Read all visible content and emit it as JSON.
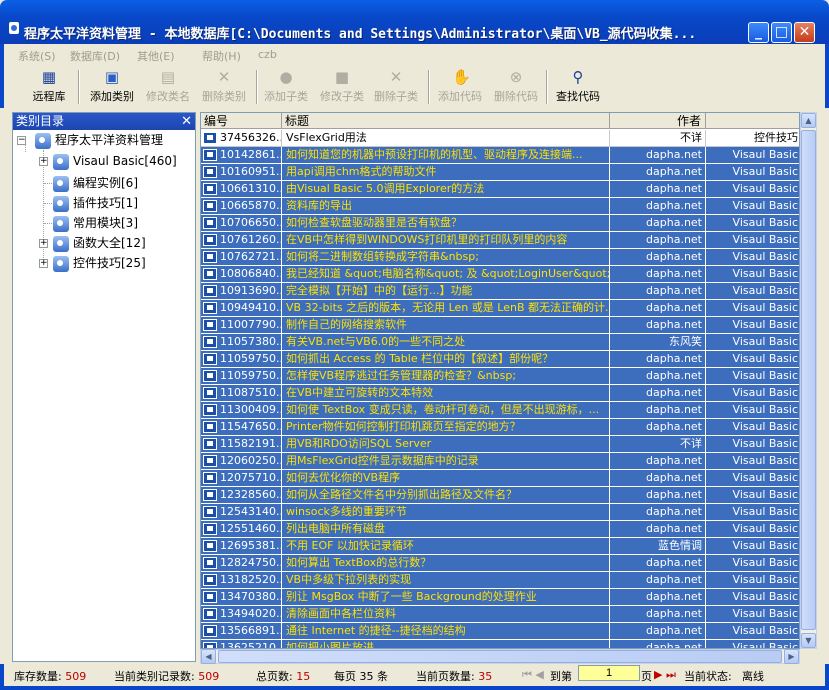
{
  "window": {
    "title": "程序太平洋资料管理 - 本地数据库[C:\\Documents and Settings\\Administrator\\桌面\\VB_源代码收集..."
  },
  "menu": [
    "系统(S)",
    "数据库(D)",
    "其他(E)",
    "帮助(H)",
    "czb"
  ],
  "toolbar": {
    "remote": "远程库",
    "add_category": "添加类别",
    "rename_category": "修改类名",
    "delete_category": "删除类别",
    "add_subcategory": "添加子类",
    "edit_subcategory": "修改子类",
    "delete_subcategory": "删除子类",
    "add_code": "添加代码",
    "delete_code": "删除代码",
    "find_code": "查找代码"
  },
  "catalog": {
    "header": "类别目录",
    "root": "程序太平洋资料管理",
    "items": [
      "Visaul Basic[460]",
      "编程实例[6]",
      "插件技巧[1]",
      "常用模块[3]",
      "函数大全[12]",
      "控件技巧[25]"
    ]
  },
  "grid": {
    "columns": [
      "编号",
      "标题",
      "作者",
      ""
    ],
    "rows": [
      {
        "id": "37456326...",
        "title": "VsFlexGrid用法",
        "author": "不详",
        "cat": "控件技巧"
      },
      {
        "id": "10142861...",
        "title": "如何知道您的机器中预设打印机的机型、驱动程序及连接端...",
        "author": "dapha.net",
        "cat": "Visaul Basic"
      },
      {
        "id": "10160951...",
        "title": "用api调用chm格式的帮助文件",
        "author": "dapha.net",
        "cat": "Visaul Basic"
      },
      {
        "id": "10661310...",
        "title": "由Visual Basic 5.0调用Explorer的方法",
        "author": "dapha.net",
        "cat": "Visaul Basic"
      },
      {
        "id": "10665870...",
        "title": "资料库的导出",
        "author": "dapha.net",
        "cat": "Visaul Basic"
      },
      {
        "id": "10706650...",
        "title": "如何检查软盘驱动器里是否有软盘？",
        "author": "dapha.net",
        "cat": "Visaul Basic"
      },
      {
        "id": "10761260...",
        "title": "在VB中怎样得到WINDOWS打印机里的打印队列里的内容",
        "author": "dapha.net",
        "cat": "Visaul Basic"
      },
      {
        "id": "10762721...",
        "title": "如何将二进制数组转换成字符串&nbsp;",
        "author": "dapha.net",
        "cat": "Visaul Basic"
      },
      {
        "id": "10806840...",
        "title": "我已经知道 &quot;电脑名称&quot; 及 &quot;LoginUser&quot; 的...",
        "author": "dapha.net",
        "cat": "Visaul Basic"
      },
      {
        "id": "10913690...",
        "title": "完全模拟【开始】中的【运行...】功能",
        "author": "dapha.net",
        "cat": "Visaul Basic"
      },
      {
        "id": "10949410...",
        "title": "VB 32-bits 之后的版本，无论用 Len 或是 LenB 都无法正确的计...",
        "author": "dapha.net",
        "cat": "Visaul Basic"
      },
      {
        "id": "11007790...",
        "title": "制作自己的网络搜索软件",
        "author": "dapha.net",
        "cat": "Visaul Basic"
      },
      {
        "id": "11057380...",
        "title": "有关VB.net与VB6.0的一些不同之处",
        "author": "东风笑",
        "cat": "Visaul Basic"
      },
      {
        "id": "11059750...",
        "title": "如何抓出 Access 的 Table 栏位中的【叙述】部份呢？",
        "author": "dapha.net",
        "cat": "Visaul Basic"
      },
      {
        "id": "11059750...",
        "title": "怎样使VB程序逃过任务管理器的检查？&nbsp;",
        "author": "dapha.net",
        "cat": "Visaul Basic"
      },
      {
        "id": "11087510...",
        "title": "在VB中建立可旋转的文本特效",
        "author": "dapha.net",
        "cat": "Visaul Basic"
      },
      {
        "id": "11300409...",
        "title": "如何使 TextBox 变成只读，卷动杆可卷动，但是不出现游标，...",
        "author": "dapha.net",
        "cat": "Visaul Basic"
      },
      {
        "id": "11547650...",
        "title": "Printer物件如何控制打印机跳页至指定的地方？",
        "author": "dapha.net",
        "cat": "Visaul Basic"
      },
      {
        "id": "11582191...",
        "title": "用VB和RDO访问SQL Server",
        "author": "不详",
        "cat": "Visaul Basic"
      },
      {
        "id": "12060250...",
        "title": "用MsFlexGrid控件显示数据库中的记录",
        "author": "dapha.net",
        "cat": "Visaul Basic"
      },
      {
        "id": "12075710...",
        "title": "如何去优化你的VB程序",
        "author": "dapha.net",
        "cat": "Visaul Basic"
      },
      {
        "id": "12328560...",
        "title": "如何从全路径文件名中分别抓出路径及文件名？",
        "author": "dapha.net",
        "cat": "Visaul Basic"
      },
      {
        "id": "12543140...",
        "title": "winsock多线的重要环节",
        "author": "dapha.net",
        "cat": "Visaul Basic"
      },
      {
        "id": "12551460...",
        "title": "列出电脑中所有磁盘",
        "author": "dapha.net",
        "cat": "Visaul Basic"
      },
      {
        "id": "12695381...",
        "title": "不用 EOF 以加快记录循环",
        "author": "蓝色情调",
        "cat": "Visaul Basic"
      },
      {
        "id": "12824750...",
        "title": "如何算出 TextBox的总行数？",
        "author": "dapha.net",
        "cat": "Visaul Basic"
      },
      {
        "id": "13182520...",
        "title": "VB中多级下拉列表的实现",
        "author": "dapha.net",
        "cat": "Visaul Basic"
      },
      {
        "id": "13470380...",
        "title": "别让 MsgBox 中断了一些 Background的处理作业",
        "author": "dapha.net",
        "cat": "Visaul Basic"
      },
      {
        "id": "13494020...",
        "title": "清除画面中各栏位资料",
        "author": "dapha.net",
        "cat": "Visaul Basic"
      },
      {
        "id": "13566891...",
        "title": "通往 Internet 的捷径--捷径档的结构",
        "author": "dapha.net",
        "cat": "Visaul Basic"
      },
      {
        "id": "13625210...",
        "title": "如何把小图片放进 ...",
        "author": "dapha.net",
        "cat": "Visaul Basic"
      }
    ]
  },
  "status": {
    "stock_label": "库存数量:",
    "stock_value": "509",
    "cat_label": "当前类别记录数:",
    "cat_value": "509",
    "pages_label": "总页数:",
    "pages_value": "15",
    "per_page": "每页 35 条",
    "cur_count_label": "当前页数量:",
    "cur_count_value": "35",
    "goto_label": "到第",
    "page_value": "1",
    "page_unit": "页",
    "state_label": "当前状态:",
    "state_value": "离线"
  },
  "colors": {
    "selection": "#3D6EBE",
    "title_highlight": "#FFE100",
    "status_value": "#C00000"
  }
}
